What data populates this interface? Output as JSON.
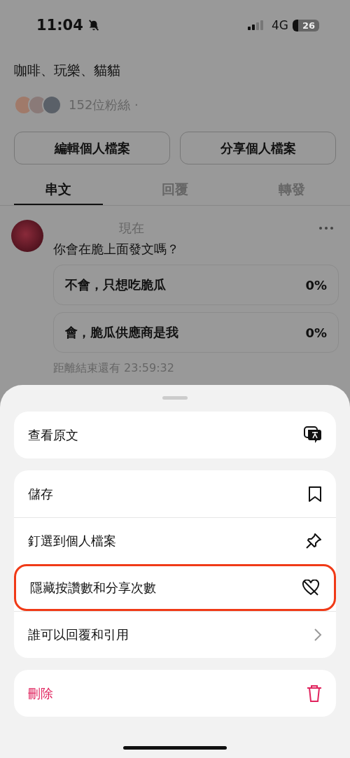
{
  "status_bar": {
    "time": "11:04",
    "network": "4G",
    "battery": "26"
  },
  "profile": {
    "bio": "咖啡、玩樂、貓貓",
    "followers": "152位粉絲 ·",
    "buttons": [
      "編輯個人檔案",
      "分享個人檔案"
    ]
  },
  "tabs": [
    {
      "label": "串文",
      "selected": true
    },
    {
      "label": "回覆",
      "selected": false
    },
    {
      "label": "轉發",
      "selected": false
    }
  ],
  "post": {
    "time": "現在",
    "text": "你會在脆上面發文嗎？",
    "poll": [
      {
        "option": "不會，只想吃脆瓜",
        "percent": "0%"
      },
      {
        "option": "會，脆瓜供應商是我",
        "percent": "0%"
      }
    ],
    "remaining": "距離結束還有 23:59:32"
  },
  "sheet": {
    "groups": [
      [
        {
          "label": "查看原文",
          "kind": "translate",
          "highlighted": false
        }
      ],
      [
        {
          "label": "儲存",
          "kind": "save",
          "highlighted": false
        },
        {
          "label": "釘選到個人檔案",
          "kind": "pin",
          "highlighted": false
        },
        {
          "label": "隱藏按讚數和分享次數",
          "kind": "hide",
          "highlighted": true
        },
        {
          "label": "誰可以回覆和引用",
          "kind": "submenu",
          "highlighted": false
        }
      ],
      [
        {
          "label": "刪除",
          "kind": "delete",
          "highlighted": false
        }
      ]
    ]
  }
}
